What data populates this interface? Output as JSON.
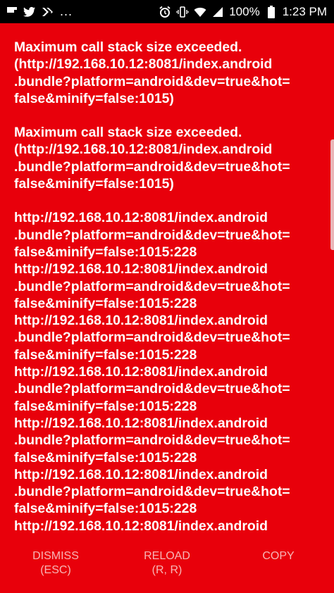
{
  "status_bar": {
    "left_icons": [
      "flipboard-icon",
      "twitter-icon",
      "feedly-icon"
    ],
    "more_dots": "...",
    "right_icons": [
      "alarm-icon",
      "vibrate-icon",
      "wifi-icon",
      "signal-icon"
    ],
    "battery": "100%",
    "time": "1:23 PM"
  },
  "error": {
    "messages": [
      "Maximum call stack size exceeded.\n(http://192.168.10.12:8081/index.android\n.bundle?platform=android&dev=true&hot=\nfalse&minify=false:1015)",
      "Maximum call stack size exceeded.\n(http://192.168.10.12:8081/index.android\n.bundle?platform=android&dev=true&hot=\nfalse&minify=false:1015)"
    ],
    "frames": [
      "http://192.168.10.12:8081/index.android\n.bundle?platform=android&dev=true&hot=\nfalse&minify=false:1015:228",
      "http://192.168.10.12:8081/index.android\n.bundle?platform=android&dev=true&hot=\nfalse&minify=false:1015:228",
      "http://192.168.10.12:8081/index.android\n.bundle?platform=android&dev=true&hot=\nfalse&minify=false:1015:228",
      "http://192.168.10.12:8081/index.android\n.bundle?platform=android&dev=true&hot=\nfalse&minify=false:1015:228",
      "http://192.168.10.12:8081/index.android\n.bundle?platform=android&dev=true&hot=\nfalse&minify=false:1015:228",
      "http://192.168.10.12:8081/index.android\n.bundle?platform=android&dev=true&hot=\nfalse&minify=false:1015:228",
      "http://192.168.10.12:8081/index.android"
    ]
  },
  "buttons": {
    "dismiss": {
      "label": "DISMISS",
      "shortcut": "(ESC)"
    },
    "reload": {
      "label": "RELOAD",
      "shortcut": "(R, R)"
    },
    "copy": {
      "label": "COPY",
      "shortcut": ""
    }
  },
  "colors": {
    "background": "#e8000b",
    "text": "#ffffff",
    "button_text": "#f7b6b6",
    "status_bar": "#000000"
  }
}
